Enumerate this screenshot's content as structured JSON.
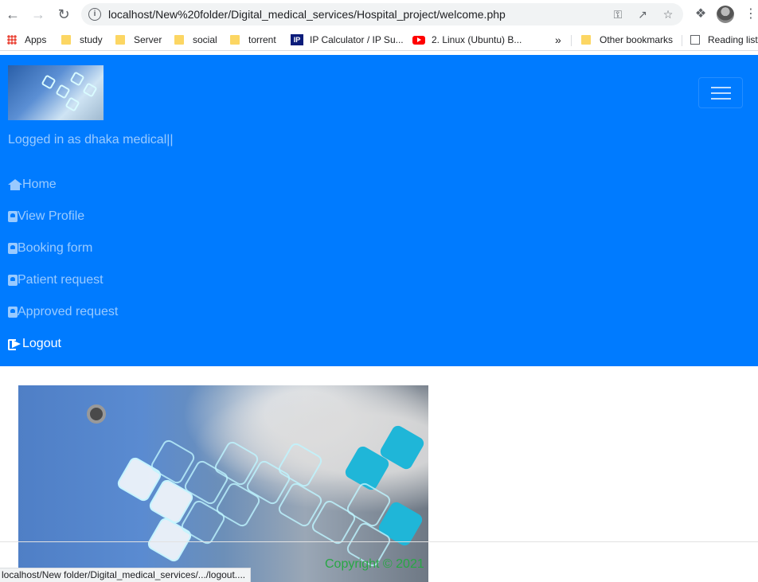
{
  "browser": {
    "url": "localhost/New%20folder/Digital_medical_services/Hospital_project/welcome.php",
    "bookmarks": [
      {
        "label": "Apps",
        "icon": "apps-grid-icon"
      },
      {
        "label": "study",
        "icon": "folder-icon"
      },
      {
        "label": "Server",
        "icon": "folder-icon"
      },
      {
        "label": "social",
        "icon": "folder-icon"
      },
      {
        "label": "torrent",
        "icon": "folder-icon"
      },
      {
        "label": "IP Calculator / IP Su...",
        "icon": "ip-icon"
      },
      {
        "label": "2. Linux (Ubuntu) B...",
        "icon": "youtube-icon"
      }
    ],
    "overflow": "»",
    "other_bookmarks": "Other bookmarks",
    "reading_list": "Reading list",
    "status_url": "localhost/New folder/Digital_medical_services/.../logout...."
  },
  "navbar": {
    "logged_in": "Logged in as dhaka medical||",
    "items": [
      {
        "label": "Home",
        "icon": "home-icon",
        "active": false
      },
      {
        "label": "View Profile",
        "icon": "address-book-icon",
        "active": false
      },
      {
        "label": "Booking form",
        "icon": "address-book-icon",
        "active": false
      },
      {
        "label": "Patient request",
        "icon": "address-book-icon",
        "active": false
      },
      {
        "label": "Approved request",
        "icon": "address-book-icon",
        "active": false
      },
      {
        "label": "Logout",
        "icon": "sign-out-icon",
        "active": true
      }
    ]
  },
  "footer": {
    "copyright": "Copyright © 2021"
  },
  "colors": {
    "navbar_bg": "#007bff",
    "copyright": "#28a745"
  }
}
